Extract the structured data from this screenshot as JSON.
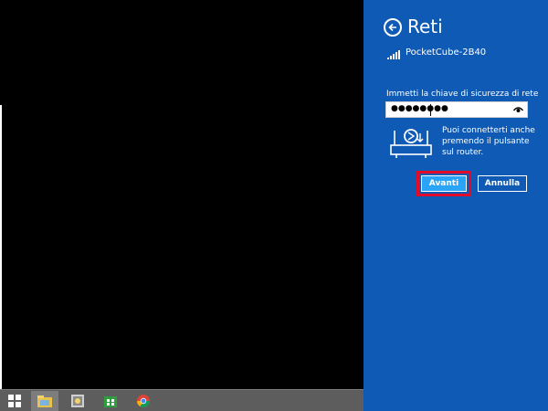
{
  "networks_panel": {
    "title": "Reti",
    "network_name": "PocketCube-2B40",
    "key_label": "Immetti la chiave di sicurezza di rete",
    "password_masked": "●●●●●●●●",
    "router_hint": "Puoi connetterti anche premendo il pulsante sul router.",
    "next_button": "Avanti",
    "cancel_button": "Annulla",
    "accent_color": "#0f5ab4",
    "highlight_color": "#e30b2a"
  },
  "taskbar": {
    "items": [
      "windows-logo-icon",
      "file-explorer-icon",
      "control-panel-icon",
      "store-icon",
      "chrome-icon"
    ]
  }
}
